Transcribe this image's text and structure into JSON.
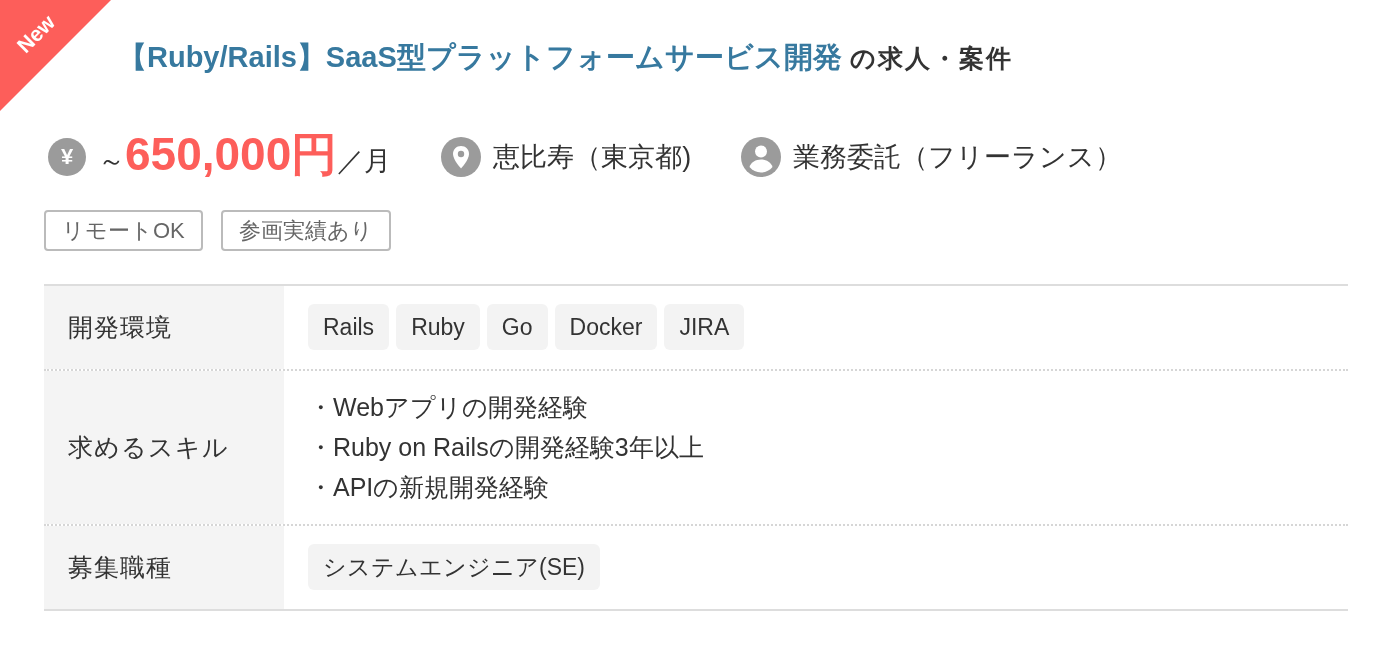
{
  "ribbon": {
    "label": "New"
  },
  "title": {
    "link": "【Ruby/Rails】SaaS型プラットフォームサービス開発",
    "suffix": "の求人・案件"
  },
  "summary": [
    {
      "kind": "salary",
      "symbol": "¥",
      "prefix": "～",
      "amount": "650,000円",
      "unit": "／月"
    },
    {
      "kind": "location",
      "text": "恵比寿（東京都)"
    },
    {
      "kind": "contract",
      "text": "業務委託（フリーランス）"
    }
  ],
  "tags": [
    "リモートOK",
    "参画実績あり"
  ],
  "details": [
    {
      "label": "開発環境",
      "kind": "chips",
      "values": [
        "Rails",
        "Ruby",
        "Go",
        "Docker",
        "JIRA"
      ]
    },
    {
      "label": "求めるスキル",
      "kind": "list",
      "values": [
        "・Webアプリの開発経験",
        "・Ruby on Railsの開発経験3年以上",
        "・APIの新規開発経験"
      ]
    },
    {
      "label": "募集職種",
      "kind": "chips",
      "values": [
        "システムエンジニア(SE)"
      ]
    }
  ]
}
